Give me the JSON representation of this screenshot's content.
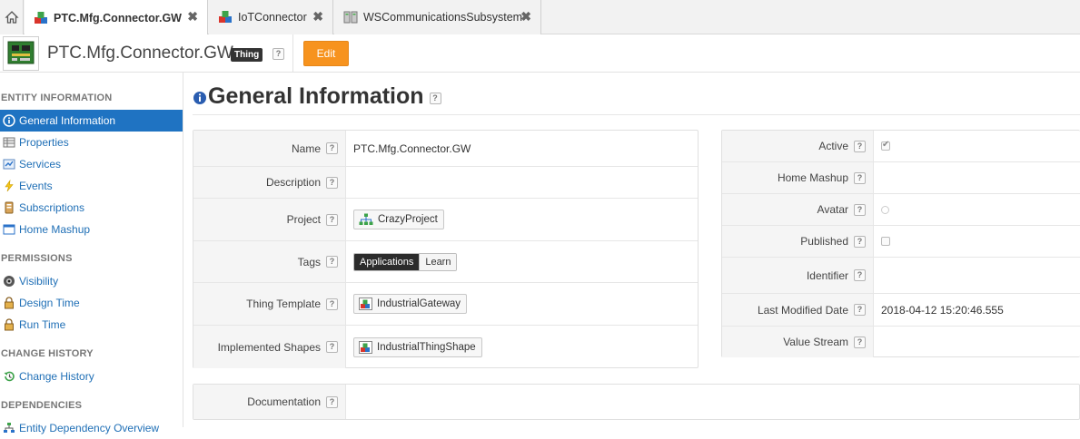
{
  "tabs": [
    {
      "label": "PTC.Mfg.Connector.GW",
      "active": true
    },
    {
      "label": "IoTConnector",
      "active": false
    },
    {
      "label": "WSCommunicationsSubsystem",
      "active": false
    }
  ],
  "tab_close_glyph": "✖",
  "header": {
    "title": "PTC.Mfg.Connector.GW",
    "badge": "Thing",
    "help": "?",
    "edit_label": "Edit"
  },
  "sidebar": {
    "sections": [
      {
        "heading": "ENTITY INFORMATION",
        "items": [
          {
            "label": "General Information",
            "icon": "info-icon",
            "active": true
          },
          {
            "label": "Properties",
            "icon": "properties-icon"
          },
          {
            "label": "Services",
            "icon": "services-icon"
          },
          {
            "label": "Events",
            "icon": "lightning-icon"
          },
          {
            "label": "Subscriptions",
            "icon": "subscriptions-icon"
          },
          {
            "label": "Home Mashup",
            "icon": "mashup-icon"
          }
        ]
      },
      {
        "heading": "PERMISSIONS",
        "items": [
          {
            "label": "Visibility",
            "icon": "visibility-icon"
          },
          {
            "label": "Design Time",
            "icon": "lock-icon"
          },
          {
            "label": "Run Time",
            "icon": "lock-icon"
          }
        ]
      },
      {
        "heading": "CHANGE HISTORY",
        "items": [
          {
            "label": "Change History",
            "icon": "history-icon"
          }
        ]
      },
      {
        "heading": "DEPENDENCIES",
        "items": [
          {
            "label": "Entity Dependency Overview",
            "icon": "dependency-icon"
          }
        ]
      }
    ]
  },
  "main": {
    "title": "General Information",
    "help": "?",
    "left_panel": {
      "name": {
        "label": "Name",
        "value": "PTC.Mfg.Connector.GW"
      },
      "description": {
        "label": "Description",
        "value": ""
      },
      "project": {
        "label": "Project",
        "value": "CrazyProject",
        "icon": "project-tree-icon"
      },
      "tags": {
        "label": "Tags",
        "values": [
          "Applications",
          "Learn"
        ]
      },
      "thing_template": {
        "label": "Thing Template",
        "value": "IndustrialGateway",
        "icon": "thing-template-icon"
      },
      "implemented_shapes": {
        "label": "Implemented Shapes",
        "value": "IndustrialThingShape",
        "icon": "thing-shape-icon"
      }
    },
    "documentation": {
      "label": "Documentation",
      "value": ""
    },
    "right_panel": {
      "active": {
        "label": "Active",
        "checked": true
      },
      "home_mashup": {
        "label": "Home Mashup",
        "value": ""
      },
      "avatar": {
        "label": "Avatar"
      },
      "published": {
        "label": "Published",
        "checked": false
      },
      "identifier": {
        "label": "Identifier",
        "value": ""
      },
      "last_modified": {
        "label": "Last Modified Date",
        "value": "2018-04-12 15:20:46.555"
      },
      "value_stream": {
        "label": "Value Stream",
        "value": ""
      }
    }
  },
  "colors": {
    "accent": "#1f73c2",
    "edit_button": "#f7931e",
    "badge": "#333333"
  }
}
